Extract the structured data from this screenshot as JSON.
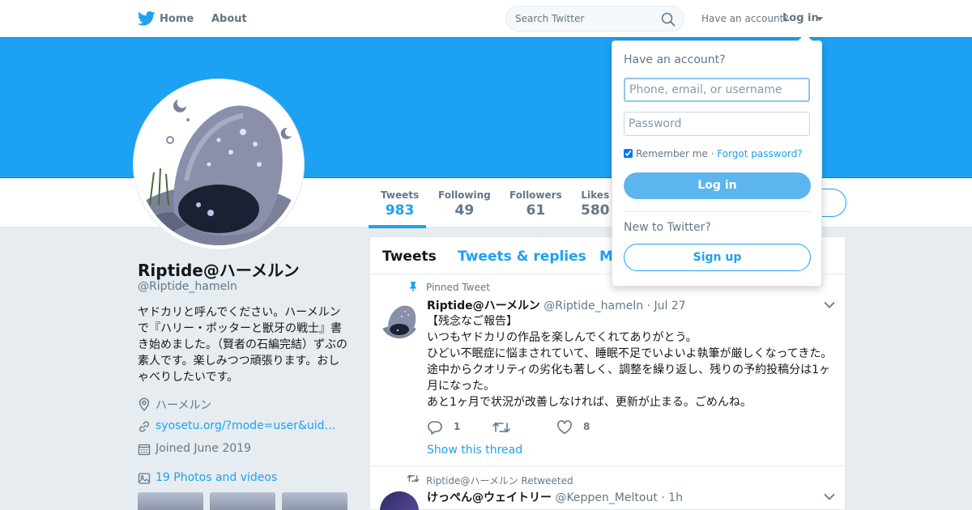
{
  "nav": {
    "home_label": "Home",
    "about_label": "About",
    "search_placeholder": "Search Twitter",
    "have_account": "Have an account?",
    "login_label": "Log in"
  },
  "profile": {
    "name": "Riptide@ハーメルン",
    "handle": "@Riptide_hameln",
    "bio": "ヤドカリと呼んでください。ハーメルンで『ハリー・ポッターと獣牙の戦士』書き始めました。（賢者の石編完結）ずぶの素人です。楽しみつつ頑張ります。おしゃべりしたいです。",
    "location": "ハーメルン",
    "website": "syosetu.org/?mode=user&uid…",
    "joined": "Joined June 2019",
    "photos_label": "19 Photos and videos"
  },
  "stats": [
    {
      "label": "Tweets",
      "value": "983"
    },
    {
      "label": "Following",
      "value": "49"
    },
    {
      "label": "Followers",
      "value": "61"
    },
    {
      "label": "Likes",
      "value": "580"
    }
  ],
  "timeline": {
    "tabs": [
      "Tweets",
      "Tweets & replies",
      "M"
    ],
    "tweets": [
      {
        "context": "Pinned Tweet",
        "name": "Riptide@ハーメルン",
        "handle": "@Riptide_hameln",
        "dot": "·",
        "date": "Jul 27",
        "lines": [
          "【残念なご報告】",
          "いつもヤドカリの作品を楽しんでくれてありがとう。",
          "ひどい不眠症に悩まされていて、睡眠不足でいよいよ執筆が厳しくなってきた。",
          "途中からクオリティの劣化も著しく、調整を繰り返し、残りの予約投稿分は1ヶ月になった。",
          "あと1ヶ月で状況が改善しなければ、更新が止まる。ごめんね。"
        ],
        "replies": "1",
        "retweets": "",
        "likes": "8",
        "show_thread": "Show this thread"
      },
      {
        "context": "Riptide@ハーメルン Retweeted",
        "name": "けっぺん@ウェイトリー",
        "handle": "@Keppen_Meltout",
        "dot": "·",
        "date": "1h"
      }
    ]
  },
  "login_dropdown": {
    "title": "Have an account?",
    "username_placeholder": "Phone, email, or username",
    "password_placeholder": "Password",
    "remember_label": "Remember me",
    "separator": " · ",
    "forgot_label": "Forgot password?",
    "login_button": "Log in",
    "new_label": "New to Twitter?",
    "signup_button": "Sign up"
  },
  "colors": {
    "accent": "#1da1f2",
    "banner": "#1da1f2"
  }
}
